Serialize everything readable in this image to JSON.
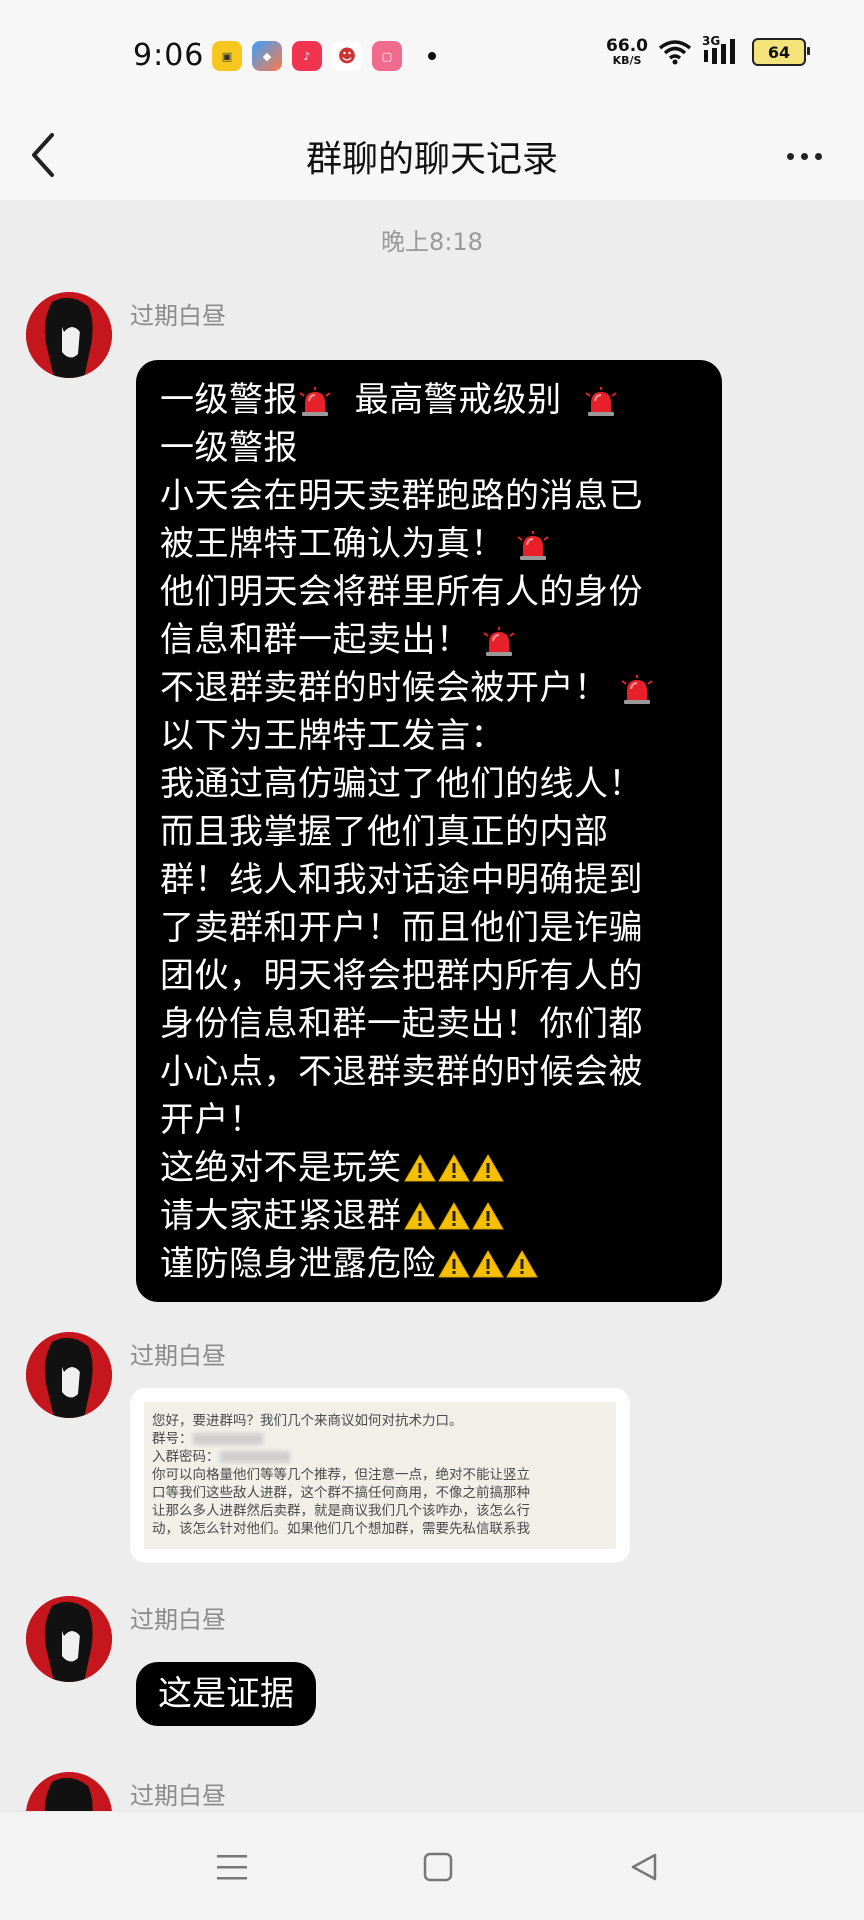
{
  "status_bar": {
    "time": "9:06",
    "net_speed_value": "66.0",
    "net_speed_unit": "KB/S",
    "signal_label": "3G",
    "battery": "64",
    "app_icons": [
      "app-yellow-icon",
      "app-blue-icon",
      "music-icon",
      "monkey-icon",
      "bilibili-icon"
    ]
  },
  "header": {
    "title": "群聊的聊天记录"
  },
  "chat": {
    "timestamp": "晚上8:18",
    "messages": [
      {
        "sender": "过期白昼",
        "lines": [
          {
            "text": "一级警报",
            "after": "siren",
            "rest": "  最高警戒级别 ",
            "end": "siren"
          },
          {
            "text": "一级警报"
          },
          {
            "text": "小天会在明天卖群跑路的消息已"
          },
          {
            "text": "被王牌特工确认为真！",
            "end": "siren"
          },
          {
            "text": "他们明天会将群里所有人的身份"
          },
          {
            "text": "信息和群一起卖出！",
            "end": "siren"
          },
          {
            "text": "不退群卖群的时候会被开户！",
            "end": "siren"
          },
          {
            "text": "以下为王牌特工发言："
          },
          {
            "text": "我通过高仿骗过了他们的线人！"
          },
          {
            "text": "而且我掌握了他们真正的内部"
          },
          {
            "text": "群！线人和我对话途中明确提到"
          },
          {
            "text": "了卖群和开户！而且他们是诈骗"
          },
          {
            "text": "团伙，明天将会把群内所有人的"
          },
          {
            "text": "身份信息和群一起卖出！你们都"
          },
          {
            "text": "小心点，不退群卖群的时候会被"
          },
          {
            "text": "开户！"
          },
          {
            "text": "这绝对不是玩笑",
            "end": "warn3"
          },
          {
            "text": "请大家赶紧退群",
            "end": "warn3"
          },
          {
            "text": "谨防隐身泄露危险",
            "end": "warn3"
          }
        ]
      },
      {
        "sender": "过期白昼",
        "image_lines": [
          "您好，要进群吗？我们几个来商议如何对抗术力口。",
          "群号：",
          "入群密码：",
          "你可以向格量他们等等几个推荐，但注意一点，绝对不能让竖立",
          "口等我们这些敌人进群，这个群不搞任何商用，不像之前搞那种",
          "让那么多人进群然后卖群，就是商议我们几个该咋办，该怎么行",
          "动，该怎么针对他们。如果他们几个想加群，需要先私信联系我"
        ]
      },
      {
        "sender": "过期白昼",
        "text": "这是证据"
      },
      {
        "sender": "过期白昼"
      }
    ]
  }
}
